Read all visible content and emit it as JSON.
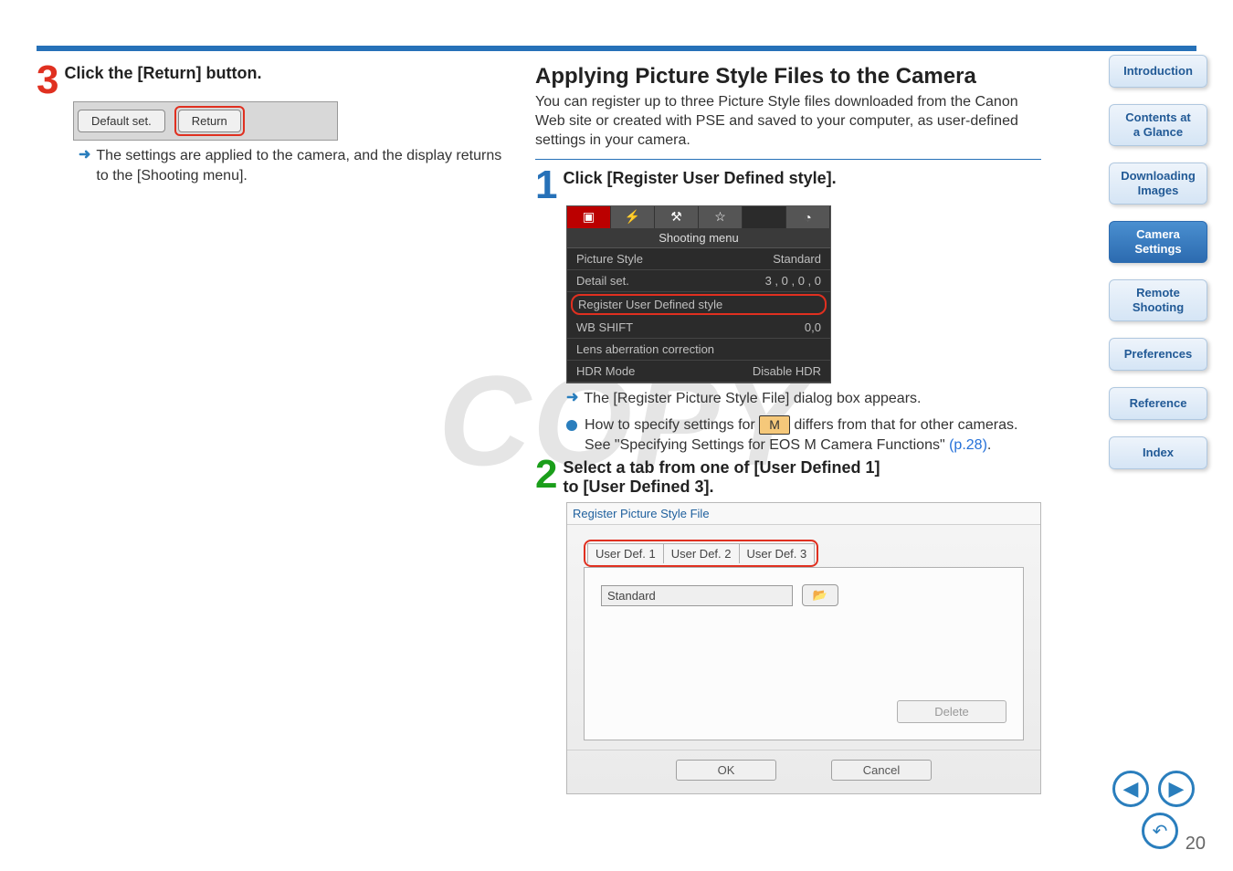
{
  "left": {
    "step_num": "3",
    "step_title": "Click the [Return] button.",
    "buttons": {
      "default_set": "Default set.",
      "return": "Return"
    },
    "result": "The settings are applied to the camera, and the display returns to the [Shooting menu]."
  },
  "right": {
    "section_title": "Applying Picture Style Files to the Camera",
    "section_body": "You can register up to three Picture Style files downloaded from the Canon Web site or created with PSE and saved to your computer, as user-defined settings in your camera.",
    "step1_num": "1",
    "step1_title": "Click [Register User Defined style].",
    "menu": {
      "header": "Shooting menu",
      "rows": [
        {
          "label": "Picture Style",
          "value": "Standard"
        },
        {
          "label": "Detail set.",
          "value": "3 , 0 , 0 , 0"
        }
      ],
      "highlight": "Register User Defined style",
      "rows2": [
        {
          "label": "WB SHIFT",
          "value": "0,0"
        },
        {
          "label": "Lens aberration correction",
          "value": ""
        },
        {
          "label": "HDR Mode",
          "value": "Disable HDR"
        }
      ]
    },
    "result1": "The [Register Picture Style File] dialog box appears.",
    "bullet2_pre": "How to specify settings for ",
    "bullet2_badge": "M",
    "bullet2_post": " differs from that for other cameras.",
    "bullet2_note_pre": "See \"Specifying Settings for EOS M Camera Functions\" ",
    "bullet2_note_link": "(p.28)",
    "bullet2_note_post": ".",
    "step2_num": "2",
    "step2_title_l1": "Select a tab from one of [User Defined 1]",
    "step2_title_l2": "to [User Defined 3].",
    "dialog": {
      "title": "Register Picture Style File",
      "tabs": [
        "User Def. 1",
        "User Def. 2",
        "User Def. 3"
      ],
      "select_value": "Standard",
      "delete": "Delete",
      "ok": "OK",
      "cancel": "Cancel"
    }
  },
  "sidebar": {
    "intro": "Introduction",
    "contents_l1": "Contents at",
    "contents_l2": "a Glance",
    "dl_l1": "Downloading",
    "dl_l2": "Images",
    "cam_l1": "Camera",
    "cam_l2": "Settings",
    "rem_l1": "Remote",
    "rem_l2": "Shooting",
    "pref": "Preferences",
    "ref": "Reference",
    "index": "Index"
  },
  "page_num": "20",
  "watermark": "COPY"
}
